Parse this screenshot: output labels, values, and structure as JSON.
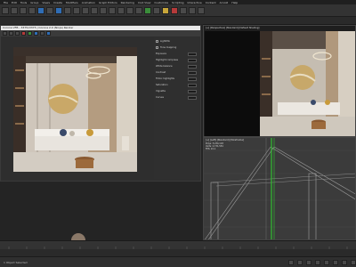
{
  "menubar": {
    "items": [
      "File",
      "Edit",
      "Tools",
      "Group",
      "Views",
      "Create",
      "Modifiers",
      "Animation",
      "Graph Editors",
      "Rendering",
      "Civil View",
      "Customize",
      "Scripting",
      "Interactive",
      "Content",
      "Arnold",
      "Help"
    ]
  },
  "framebuffer": {
    "title": "Corona VFB - 3375x3375 | Corona 2.0 (Ninja) Render",
    "side_rows": [
      "LightMix",
      "Tone mapping",
      "Exposure",
      "Highlight compress",
      "White balance",
      "Contrast",
      "Filmic highlights",
      "Saturation",
      "Vignette",
      "Curves"
    ]
  },
  "viewport_top": {
    "label": "[+] [Perspective] [Standard] [Default Shading]"
  },
  "viewport_bottom": {
    "label": "[+] [Left] [Standard] [Wireframe]",
    "info": [
      "Polys: 5,234,118",
      "Verts: 2,731,554",
      "FPS: 24.1"
    ]
  },
  "status": {
    "text": "1 Object Selected"
  },
  "colors": {
    "accent_yellow": "#d8c64a",
    "grid_green": "#2fc12f"
  }
}
